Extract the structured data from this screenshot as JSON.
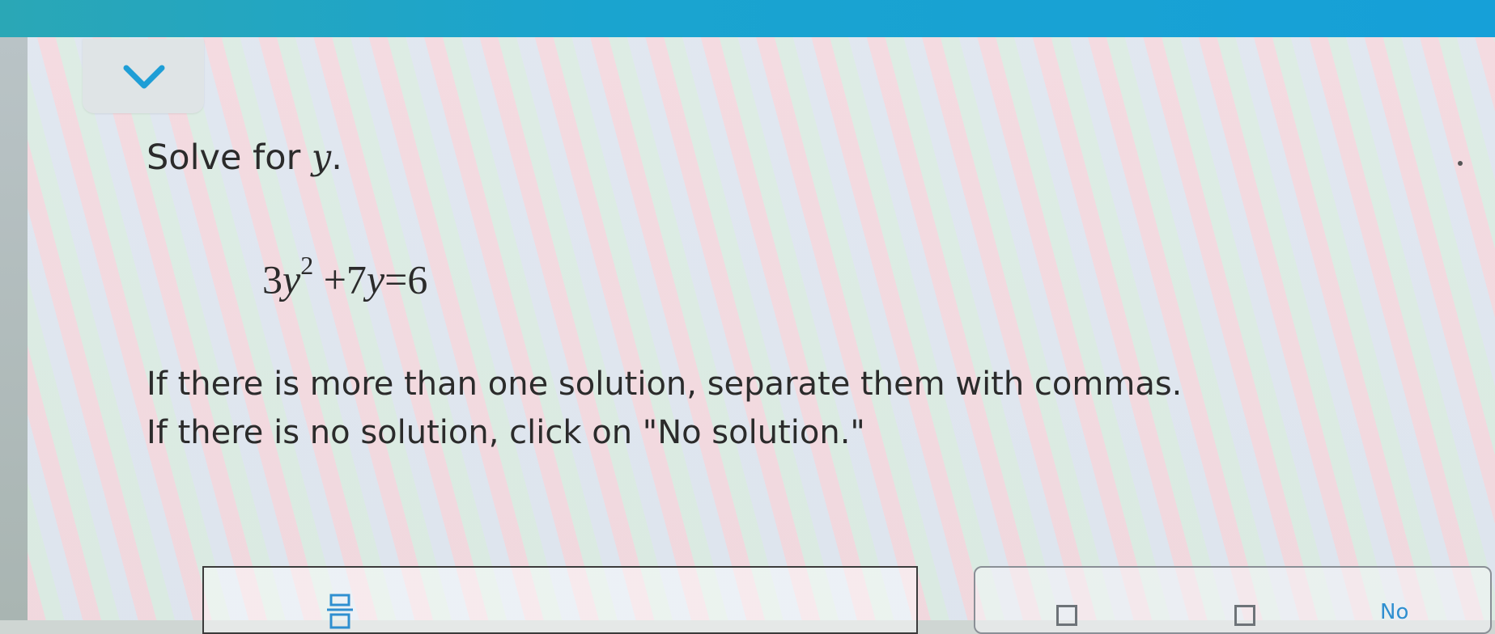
{
  "colors": {
    "top_bar": "#16a0d8",
    "accent": "#2f8fd0",
    "text": "#2b2b2b"
  },
  "question": {
    "prompt_prefix": "Solve for ",
    "prompt_var": "y",
    "prompt_suffix": ".",
    "equation": {
      "coef1": "3",
      "var1": "y",
      "exp1": "2",
      "op1": "+",
      "coef2": "7",
      "var2": "y",
      "eq": "=",
      "rhs": "6"
    },
    "instruction_line1": "If there is more than one solution, separate them with commas.",
    "instruction_line2": "If there is no solution, click on \"No solution.\""
  },
  "answer": {
    "value": "",
    "icon": "fraction-input-icon"
  },
  "keypad": {
    "no_solution_label": "No",
    "key_icons": [
      "square-key-icon",
      "square-key-icon"
    ]
  },
  "collapse": {
    "icon": "chevron-down-icon"
  }
}
